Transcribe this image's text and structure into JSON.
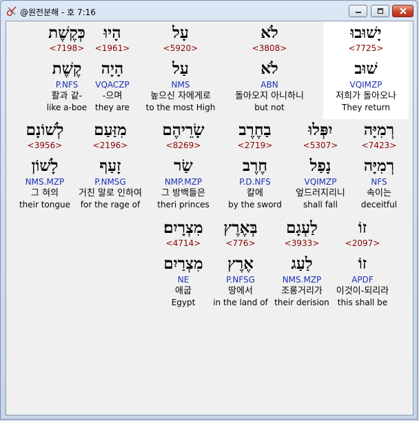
{
  "window": {
    "title": "@원전분해 - 호 7:16"
  },
  "rows": [
    [
      {
        "heb": "יָשׁוּבוּ",
        "num": "<7725>",
        "lemma": "שׁוּב",
        "gram": "VQIMZP",
        "kor": "저희가 돌아오나",
        "eng": "They return",
        "selected": true
      },
      {
        "heb": "לֹא",
        "num": "<3808>",
        "lemma": "לֹא",
        "gram": "ABN",
        "kor": "돌아오지 아니하니",
        "eng": "but not"
      },
      {
        "heb": "עָל",
        "num": "<5920>",
        "lemma": "עַל",
        "gram": "NMS",
        "kor": "높으신 자에게로",
        "eng": "to the most High"
      },
      {
        "heb": "הָיוּ",
        "num": "<1961>",
        "lemma": "הָיָה",
        "gram": "VQACZP",
        "kor": "-으며",
        "eng": "they are"
      },
      {
        "heb": "כְּקֶשֶׁת",
        "num": "<7198>",
        "lemma": "קֶשֶׁת",
        "gram": "P.NFS",
        "kor": "활과 같-",
        "eng": "like a-boe"
      }
    ],
    [
      {
        "heb": "רְמִיָּה",
        "num": "<7423>",
        "lemma": "רְמִיָּה",
        "gram": "NFS",
        "kor": "속이는",
        "eng": "deceitful"
      },
      {
        "heb": "יִפְּלוּ",
        "num": "<5307>",
        "lemma": "נָפַל",
        "gram": "VQIMZP",
        "kor": "엎드러지리니",
        "eng": "shall fall"
      },
      {
        "heb": "בַחֶרֶב",
        "num": "<2719>",
        "lemma": "חֶרֶב",
        "gram": "P.D.NFS",
        "kor": "칼에",
        "eng": "by the sword"
      },
      {
        "heb": "שָׂרֵיהֶם",
        "num": "<8269>",
        "lemma": "שַׂר",
        "gram": "NMP.MZP",
        "kor": "그 방백들은",
        "eng": "theri princes"
      },
      {
        "heb": "מִזַּעַם",
        "num": "<2196>",
        "lemma": "זָעַף",
        "gram": "P.NMSG",
        "kor": "거친 말로 인하여",
        "eng": "for the rage of"
      },
      {
        "heb": "לְשׁוֹנָם",
        "num": "<3956>",
        "lemma": "לָשׁוֹן",
        "gram": "NMS.MZP",
        "kor": "그 혀의",
        "eng": "their tongue"
      }
    ],
    [
      {
        "heb": "זוֹ",
        "num": "<2097>",
        "lemma": "זוֹ",
        "gram": "APDF",
        "kor": "이것이-되리라",
        "eng": "this shall be"
      },
      {
        "heb": "לַעְגָם",
        "num": "<3933>",
        "lemma": "לַעַג",
        "gram": "NMS.MZP",
        "kor": "조롱거리가",
        "eng": "their derision"
      },
      {
        "heb": "בְּאֶרֶץ",
        "num": "<776>",
        "lemma": "אֶרֶץ",
        "gram": "P.NFSG",
        "kor": "땅에서",
        "eng": "in the land of"
      },
      {
        "heb": "מִצְרָיִם׃",
        "num": "<4714>",
        "lemma": "מִצְרַיִם",
        "gram": "NE",
        "kor": "애굽",
        "eng": "Egypt"
      }
    ]
  ]
}
